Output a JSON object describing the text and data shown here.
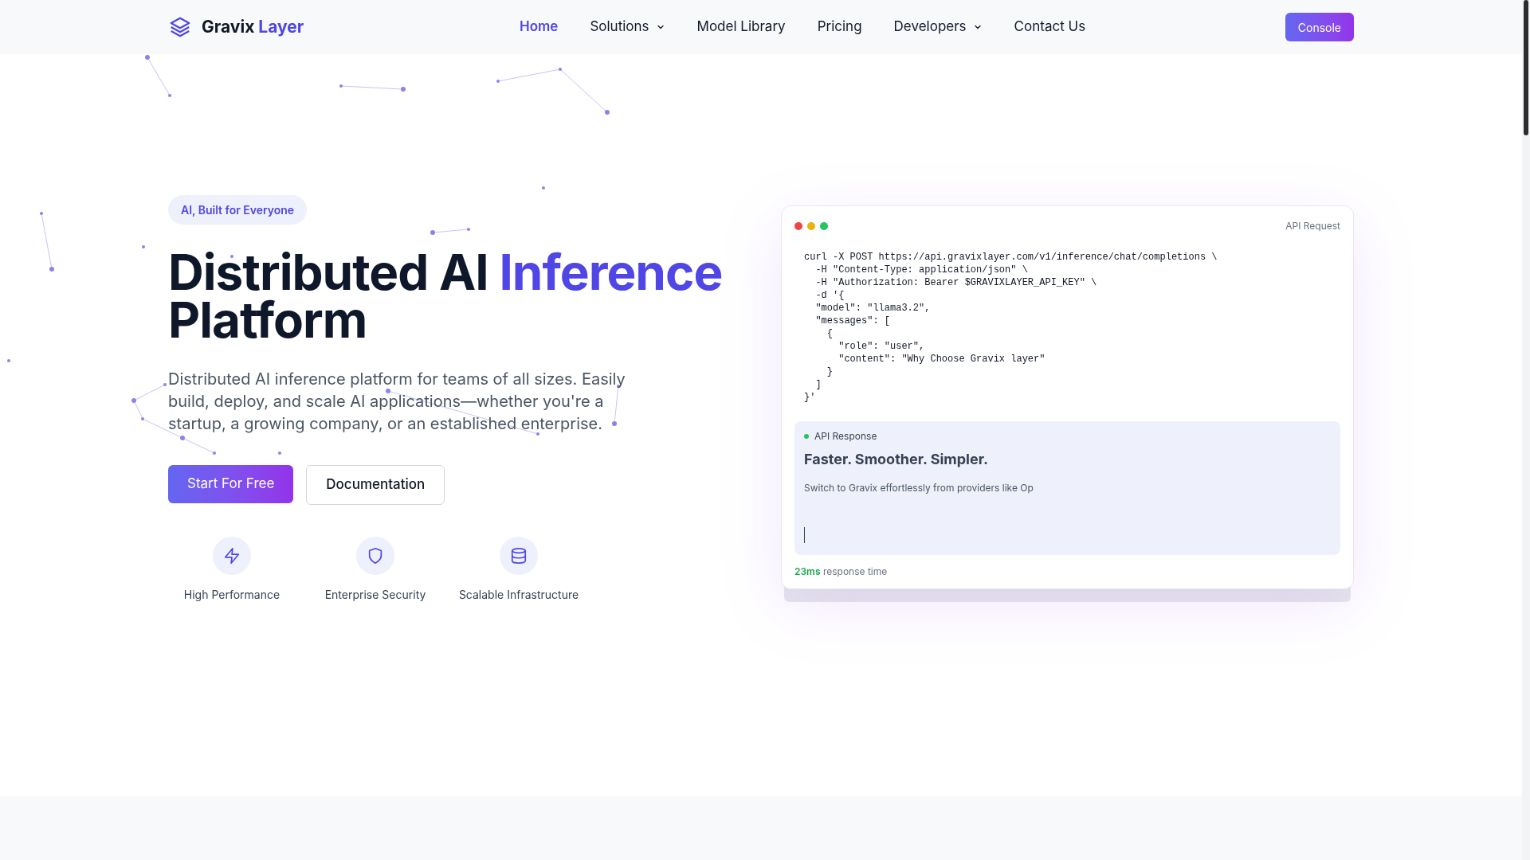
{
  "nav": {
    "logo": {
      "first": "Gravix",
      "second": "Layer"
    },
    "links": [
      {
        "label": "Home",
        "selected": true,
        "dropdown": false
      },
      {
        "label": "Solutions",
        "selected": false,
        "dropdown": true
      },
      {
        "label": "Model Library",
        "selected": false,
        "dropdown": false
      },
      {
        "label": "Pricing",
        "selected": false,
        "dropdown": false
      },
      {
        "label": "Developers",
        "selected": false,
        "dropdown": true
      },
      {
        "label": "Contact Us",
        "selected": false,
        "dropdown": false
      }
    ],
    "cta": "Console"
  },
  "hero": {
    "badge": "AI, Built for Everyone",
    "title_start": "Distributed AI",
    "title_highlight": "Inference",
    "title_end": "Platform",
    "description": "Distributed AI inference platform for teams of all sizes. Easily build, deploy, and scale AI applications—whether you're a startup, a growing company, or an established enterprise.",
    "buttons": [
      {
        "label": "Start For Free",
        "kind": "primary"
      },
      {
        "label": "Documentation",
        "kind": "secondary"
      }
    ],
    "features": [
      {
        "label": "High Performance",
        "kind": "bolt"
      },
      {
        "label": "Enterprise Security",
        "kind": "shield"
      },
      {
        "label": "Scalable Infrastructure",
        "kind": "database"
      }
    ]
  },
  "api_card": {
    "title": "API Request",
    "code_lines": [
      "curl -X POST https://api.gravixlayer.com/v1/inference/chat/completions \\",
      "  -H \"Content-Type: application/json\" \\",
      "  -H \"Authorization: Bearer $GRAVIXLAYER_API_KEY\" \\",
      "  -d '{",
      "  \"model\": \"llama3.2\",",
      "  \"messages\": [",
      "    {",
      "      \"role\": \"user\",",
      "      \"content\": \"Why Choose Gravix layer\"",
      "    }",
      "  ]",
      "}'"
    ],
    "response": {
      "label": "API Response",
      "heading": "Faster. Smoother. Simpler.",
      "text": "Switch to Gravix effortlessly from providers like Op"
    },
    "latency": {
      "value": "23ms",
      "label": "response time"
    }
  }
}
